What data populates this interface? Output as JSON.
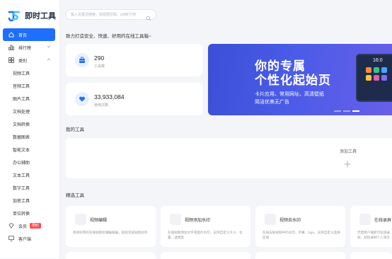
{
  "app": {
    "name": "即时工具"
  },
  "search": {
    "placeholder": "输入关键词搜索，如视频剪辑、pdf转方档"
  },
  "sidebar": {
    "items": [
      {
        "label": "首页"
      },
      {
        "label": "排行榜"
      },
      {
        "label": "类别"
      },
      {
        "label": "视频工具"
      },
      {
        "label": "音频工具"
      },
      {
        "label": "图片工具"
      },
      {
        "label": "文档处理"
      },
      {
        "label": "文档转换"
      },
      {
        "label": "数据图表"
      },
      {
        "label": "智能文本"
      },
      {
        "label": "办公辅助"
      },
      {
        "label": "文本工具"
      },
      {
        "label": "数字工具"
      },
      {
        "label": "加密工具"
      },
      {
        "label": "单位转换"
      },
      {
        "label": "会员",
        "badge": "限时"
      },
      {
        "label": "客户端"
      }
    ]
  },
  "main": {
    "slogan": "致力打造安全、快速、好用的在线工具箱~",
    "stats": [
      {
        "value": "290",
        "label": "工具数"
      },
      {
        "value": "33,933,084",
        "label": "使用次数"
      }
    ],
    "banner": {
      "title_line1": "你的专属",
      "title_line2": "个性化起始页",
      "subtitle_line1": "卡片应用、常用网址、高清壁纸",
      "subtitle_line2": "简洁优美无广告",
      "device_time": "16:0"
    },
    "my_tools": {
      "title": "我的工具",
      "add_label": "添加工具"
    },
    "featured": {
      "title": "精选工具",
      "cards": [
        {
          "name": "视频编辑",
          "desc": "简单好用的在线视频剪辑编辑器，轻松完成视频创作"
        },
        {
          "name": "视频添加水印",
          "desc": "在线视频添加文字或图片水印，支持自定义大小、位置、透明度"
        },
        {
          "name": "视频去水印",
          "desc": "在线去除视频中的水印、字幕、logo，支持自定义选择区域"
        },
        {
          "name": "在线录屏",
          "desc": "无需客户端即可在线录屏，轻松录制个人演示"
        }
      ]
    }
  },
  "colors": {
    "accent": "#1e6fff",
    "banner": "#4556e0",
    "badge": "#ff4d4f"
  }
}
